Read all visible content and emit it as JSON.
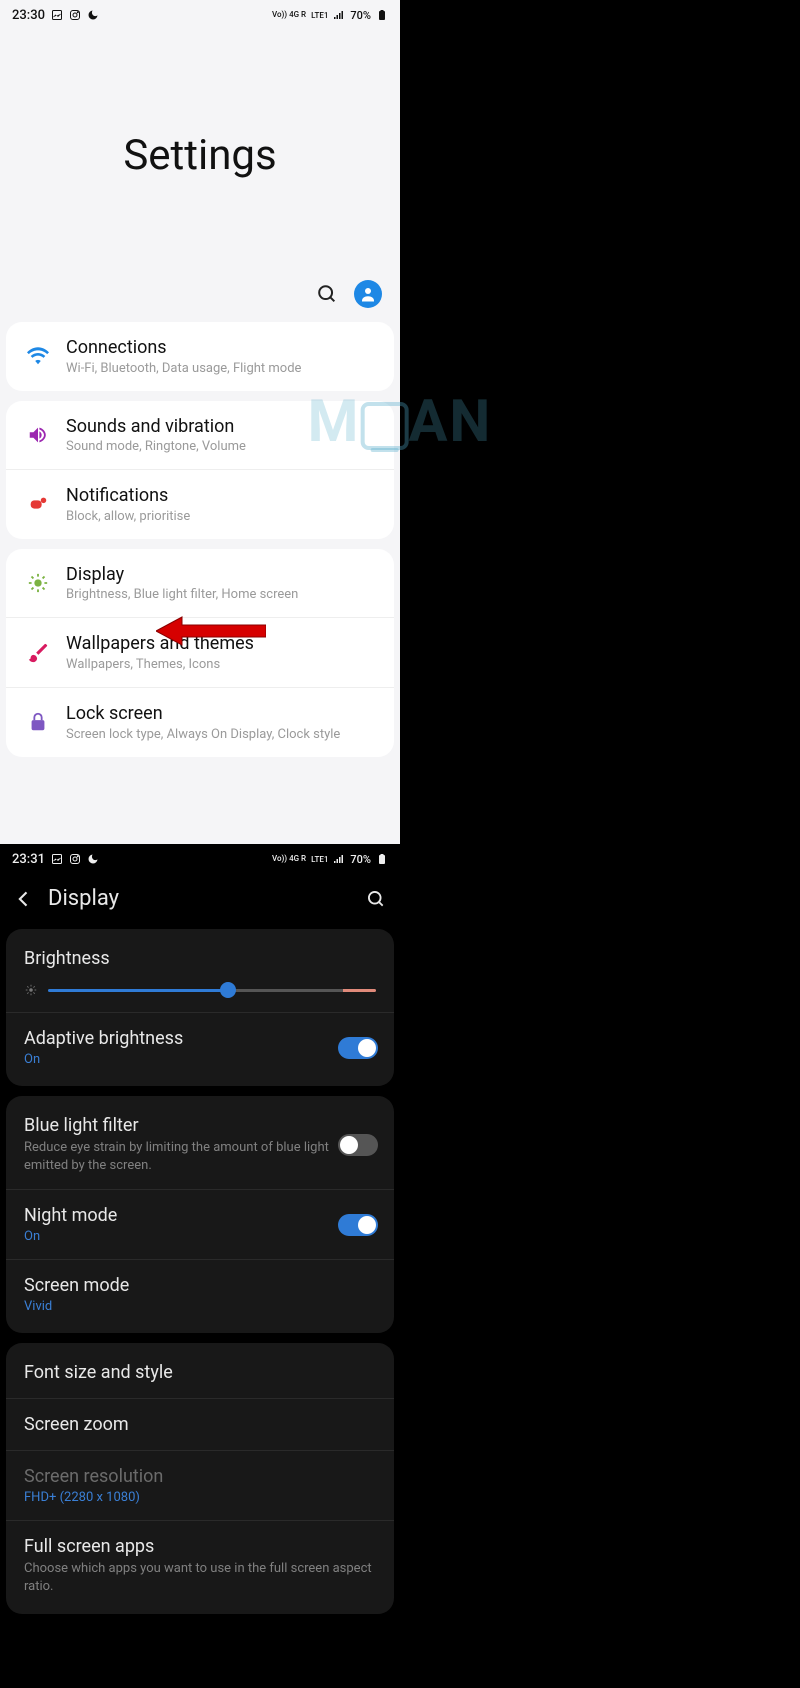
{
  "watermark": {
    "prefix": "M",
    "suffix": "AN"
  },
  "left": {
    "status": {
      "time": "23:30",
      "net": "Vo)) 4G R",
      "lte": "LTE1",
      "battery": "70%"
    },
    "title": "Settings",
    "groups": [
      {
        "items": [
          {
            "icon": "wifi",
            "color": "#1e88e5",
            "title": "Connections",
            "sub": "Wi-Fi, Bluetooth, Data usage, Flight mode"
          }
        ]
      },
      {
        "items": [
          {
            "icon": "speaker",
            "color": "#9c27b0",
            "title": "Sounds and vibration",
            "sub": "Sound mode, Ringtone, Volume"
          },
          {
            "icon": "notify",
            "color": "#e53935",
            "title": "Notifications",
            "sub": "Block, allow, prioritise"
          }
        ]
      },
      {
        "items": [
          {
            "icon": "sun",
            "color": "#7cb342",
            "title": "Display",
            "sub": "Brightness, Blue light filter, Home screen"
          },
          {
            "icon": "brush",
            "color": "#d81b60",
            "title": "Wallpapers and themes",
            "sub": "Wallpapers, Themes, Icons"
          },
          {
            "icon": "lock",
            "color": "#7e57c2",
            "title": "Lock screen",
            "sub": "Screen lock type, Always On Display, Clock style"
          }
        ]
      }
    ]
  },
  "right": {
    "status": {
      "time": "23:31",
      "net": "Vo)) 4G R",
      "lte": "LTE1",
      "battery": "70%"
    },
    "title": "Display",
    "cards": [
      {
        "rows": [
          {
            "type": "brightness",
            "title": "Brightness"
          },
          {
            "type": "toggle",
            "title": "Adaptive brightness",
            "valueBlue": "On",
            "on": true
          }
        ]
      },
      {
        "rows": [
          {
            "type": "toggle",
            "title": "Blue light filter",
            "sub": "Reduce eye strain by limiting the amount of blue light emitted by the screen.",
            "on": false
          },
          {
            "type": "toggle",
            "title": "Night mode",
            "valueBlue": "On",
            "on": true
          },
          {
            "type": "plain",
            "title": "Screen mode",
            "valueBlue": "Vivid"
          }
        ]
      },
      {
        "rows": [
          {
            "type": "plain",
            "title": "Font size and style"
          },
          {
            "type": "plain",
            "title": "Screen zoom"
          },
          {
            "type": "plain",
            "title": "Screen resolution",
            "dim": true,
            "valueBlue": "FHD+ (2280 x 1080)"
          },
          {
            "type": "plain",
            "title": "Full screen apps",
            "sub": "Choose which apps you want to use in the full screen aspect ratio."
          }
        ]
      }
    ]
  }
}
